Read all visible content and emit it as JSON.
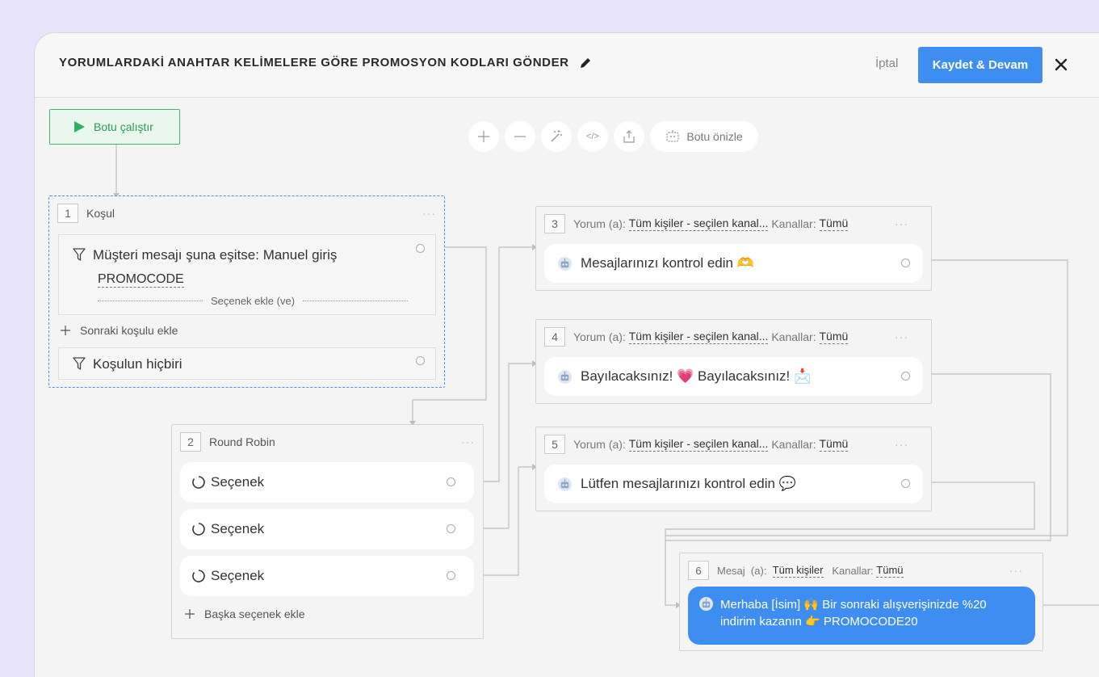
{
  "header": {
    "title": "YORUMLARDAKİ ANAHTAR KELİMELERE GÖRE PROMOSYON KODLARI GÖNDER",
    "cancel_label": "İptal",
    "save_label": "Kaydet & Devam"
  },
  "run_button": {
    "label": "Botu çalıştır"
  },
  "toolbar": {
    "preview_label": "Botu önizle",
    "code_label": "</>"
  },
  "block1": {
    "number": "1",
    "type": "Koşul",
    "condition_line1": "Müşteri mesajı şuna eşitse: Manuel giriş",
    "condition_value": "PROMOCODE",
    "add_option": "Seçenek ekle (ve)",
    "add_next": "Sonraki koşulu ekle",
    "else_label": "Koşulun hiçbiri"
  },
  "block2": {
    "number": "2",
    "type": "Round Robin",
    "options": [
      "Seçenek",
      "Seçenek",
      "Seçenek"
    ],
    "add_option": "Başka seçenek ekle"
  },
  "comment_blocks": [
    {
      "number": "3",
      "type": "Yorum",
      "to": "(a):",
      "audience": "Tüm kişiler - seçilen kanal...",
      "channels_label": "Kanallar:",
      "channels": "Tümü",
      "message": "Mesajlarınızı kontrol edin 🫶"
    },
    {
      "number": "4",
      "type": "Yorum",
      "to": "(a):",
      "audience": "Tüm kişiler - seçilen kanal...",
      "channels_label": "Kanallar:",
      "channels": "Tümü",
      "message": "Bayılacaksınız! 💗 Bayılacaksınız! 📩"
    },
    {
      "number": "5",
      "type": "Yorum",
      "to": "(a):",
      "audience": "Tüm kişiler - seçilen kanal...",
      "channels_label": "Kanallar:",
      "channels": "Tümü",
      "message": "Lütfen mesajlarınızı kontrol edin 💬"
    }
  ],
  "block6": {
    "number": "6",
    "type": "Mesaj",
    "to": "(a):",
    "audience": "Tüm kişiler",
    "channels_label": "Kanallar:",
    "channels": "Tümü",
    "message": "Merhaba [İsim] 🙌 Bir sonraki alışverişinizde %20 indirim kazanın 👉 PROMOCODE20"
  },
  "more_label": "···",
  "colors": {
    "accent": "#3d8ef0",
    "run_green": "#3fb46d",
    "background": "#e8e4fb"
  },
  "icons": [
    "pencil-icon",
    "close-icon",
    "play-icon",
    "plus-icon",
    "minus-icon",
    "magic-wand-icon",
    "code-icon",
    "share-icon",
    "bot-preview-icon",
    "filter-icon",
    "bot-avatar-icon",
    "spinner-icon"
  ]
}
